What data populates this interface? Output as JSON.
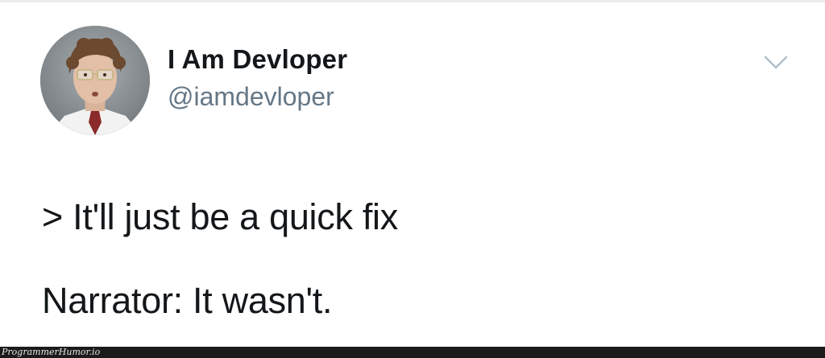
{
  "author": {
    "display_name": "I Am Devloper",
    "handle": "@iamdevloper",
    "avatar_icon": "avatar-photo"
  },
  "menu": {
    "icon": "chevron-down-icon",
    "color": "#aab8c2"
  },
  "tweet": {
    "lines": [
      "> It'll just be a quick fix",
      "Narrator: It wasn't."
    ]
  },
  "watermark": {
    "text": "ProgrammerHumor.io"
  },
  "colors": {
    "text": "#14171a",
    "secondary": "#657786",
    "watermark_bg": "#1b1b1b"
  }
}
